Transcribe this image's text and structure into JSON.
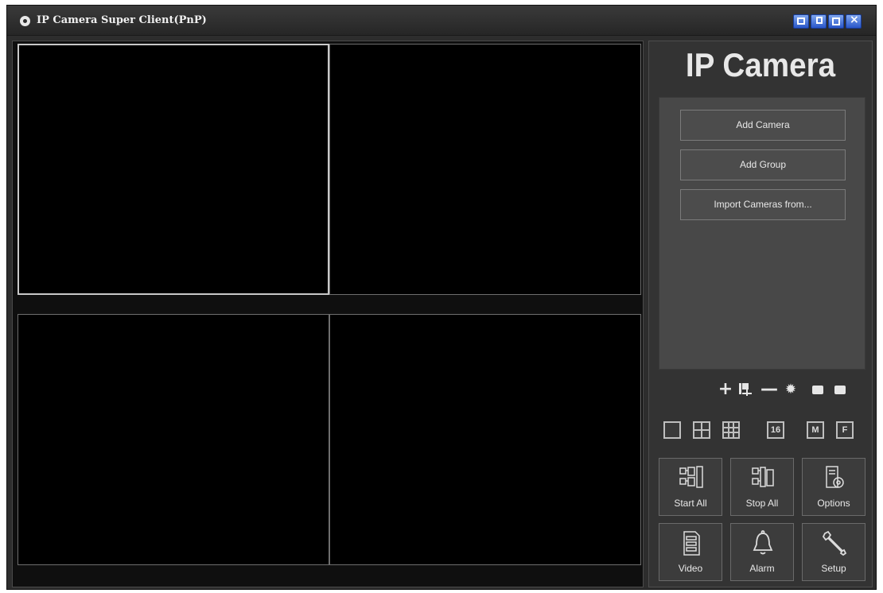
{
  "window": {
    "title": "IP Camera Super Client(PnP)"
  },
  "titlebar_buttons": [
    "tile-icon",
    "cascade-icon",
    "maximize-icon",
    "close-icon"
  ],
  "brand": {
    "logo_text": "IP Camera"
  },
  "camera_panel": {
    "add_camera_label": "Add Camera",
    "add_group_label": "Add Group",
    "import_label": "Import Cameras from..."
  },
  "toolbar_icons": [
    "add-icon",
    "add-group-icon",
    "remove-icon",
    "settings-icon",
    "edit-icon",
    "export-icon"
  ],
  "layouts": {
    "sixteen_label": "16",
    "multi_label": "M",
    "full_label": "F"
  },
  "actions": {
    "start_all": "Start All",
    "stop_all": "Stop All",
    "options": "Options",
    "video": "Video",
    "alarm": "Alarm",
    "setup": "Setup"
  },
  "colors": {
    "window_bg": "#2d2d2d",
    "video_bg": "#000000",
    "titlebar_button": "#2a57c8",
    "selected_pane_border": "#c8c8c8"
  }
}
